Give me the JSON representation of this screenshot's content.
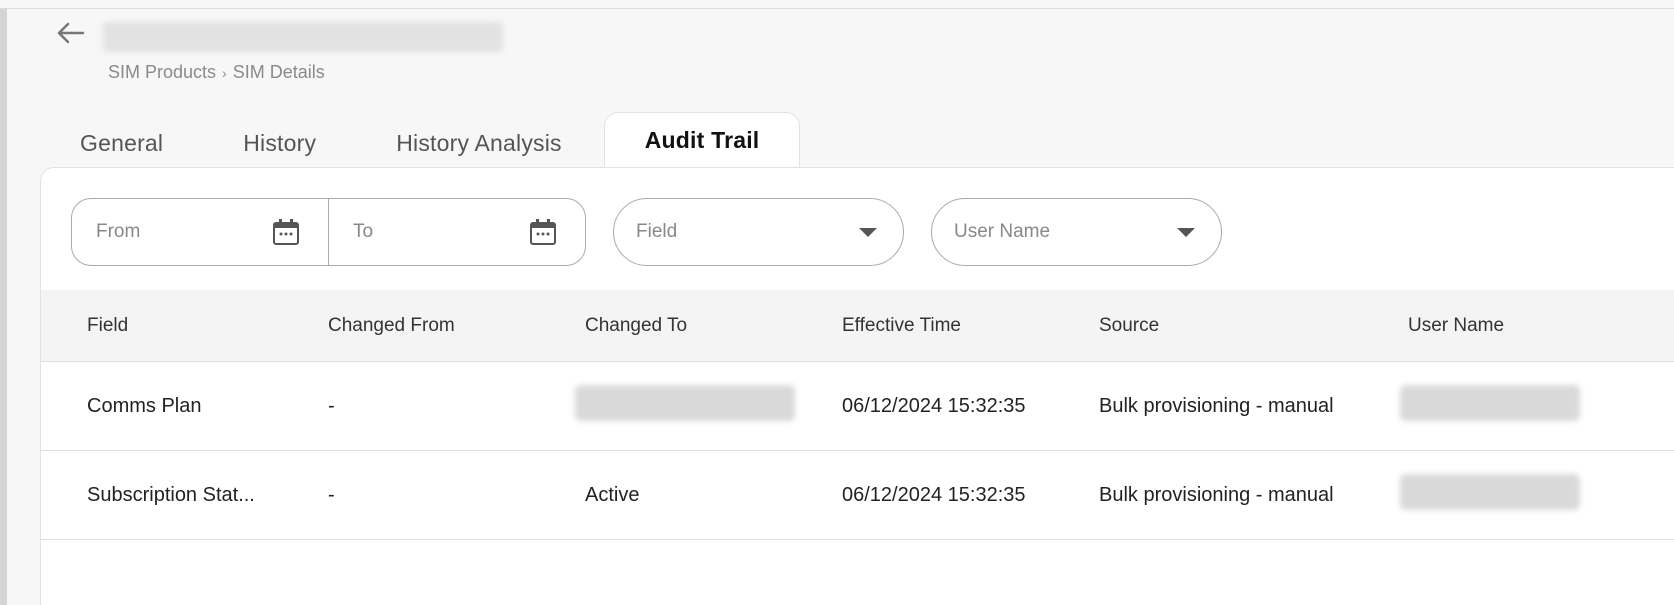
{
  "header": {
    "title": "",
    "breadcrumb": [
      "SIM Products",
      "SIM Details"
    ],
    "breadcrumb_separator": "›"
  },
  "tabs": [
    {
      "label": "General",
      "active": false
    },
    {
      "label": "History",
      "active": false
    },
    {
      "label": "History Analysis",
      "active": false
    },
    {
      "label": "Audit Trail",
      "active": true
    }
  ],
  "filters": {
    "from_placeholder": "From",
    "to_placeholder": "To",
    "field_placeholder": "Field",
    "user_placeholder": "User Name"
  },
  "table": {
    "columns": [
      "Field",
      "Changed From",
      "Changed To",
      "Effective Time",
      "Source",
      "User Name"
    ],
    "rows": [
      {
        "field": "Comms Plan",
        "changed_from": "-",
        "changed_to": "",
        "effective_time": "06/12/2024 15:32:35",
        "source": "Bulk provisioning - manual",
        "user_name": ""
      },
      {
        "field": "Subscription Stat...",
        "changed_from": "-",
        "changed_to": "Active",
        "effective_time": "06/12/2024 15:32:35",
        "source": "Bulk provisioning - manual",
        "user_name": ""
      }
    ]
  },
  "icons": {
    "back": "arrow-left-icon",
    "calendar": "calendar-icon",
    "dropdown": "chevron-down-icon"
  },
  "colors": {
    "background": "#f7f7f7",
    "panel": "#ffffff",
    "header_row": "#f4f4f4",
    "border": "#aaaaaa"
  }
}
